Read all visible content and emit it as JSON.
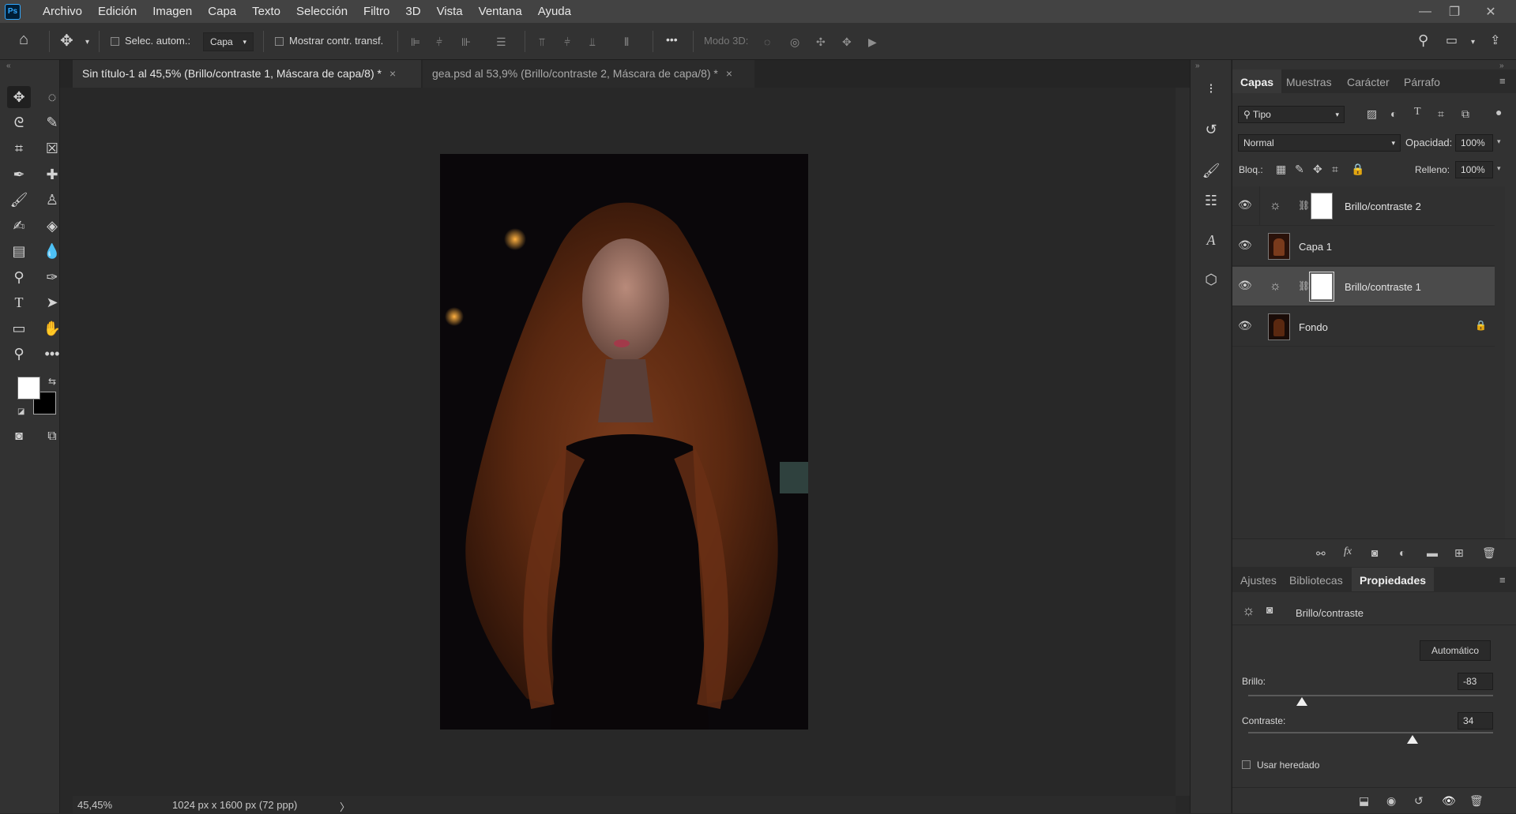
{
  "menubar": {
    "items": [
      "Archivo",
      "Edición",
      "Imagen",
      "Capa",
      "Texto",
      "Selección",
      "Filtro",
      "3D",
      "Vista",
      "Ventana",
      "Ayuda"
    ],
    "logo": "Ps"
  },
  "options": {
    "auto_select_label": "Selec. autom.:",
    "auto_select_value": "Capa",
    "show_transform_label": "Mostrar contr. transf.",
    "mode3d_label": "Modo 3D:",
    "more": "•••"
  },
  "tabs": [
    {
      "label": "Sin título-1 al 45,5% (Brillo/contraste 1, Máscara de capa/8) *",
      "close": "×"
    },
    {
      "label": "gea.psd al 53,9% (Brillo/contraste 2, Máscara de capa/8) *",
      "close": "×"
    }
  ],
  "status": {
    "zoom": "45,45%",
    "docsize": "1024 px x 1600 px (72 ppp)",
    "arrow": "〉"
  },
  "layers_panel": {
    "tabs": [
      "Capas",
      "Muestras",
      "Carácter",
      "Párrafo"
    ],
    "filter_value": "Tipo",
    "blend_mode": "Normal",
    "opacity_label": "Opacidad:",
    "opacity_value": "100%",
    "lock_label": "Bloq.:",
    "fill_label": "Relleno:",
    "fill_value": "100%",
    "layers": [
      {
        "name": "Brillo/contraste 2",
        "type": "adjustment",
        "selected": false
      },
      {
        "name": "Capa 1",
        "type": "image",
        "selected": false
      },
      {
        "name": "Brillo/contraste 1",
        "type": "adjustment",
        "selected": true
      },
      {
        "name": "Fondo",
        "type": "image",
        "selected": false,
        "locked": true
      }
    ]
  },
  "properties_panel": {
    "tabs": [
      "Ajustes",
      "Bibliotecas",
      "Propiedades"
    ],
    "title": "Brillo/contraste",
    "auto_button": "Automático",
    "brightness_label": "Brillo:",
    "brightness_value": "-83",
    "brightness_fraction": 0.22,
    "contrast_label": "Contraste:",
    "contrast_value": "34",
    "contrast_fraction": 0.67,
    "legacy_label": "Usar heredado"
  },
  "colors": {
    "foreground": "#ffffff",
    "background": "#000000",
    "accent": "#31a8ff"
  }
}
